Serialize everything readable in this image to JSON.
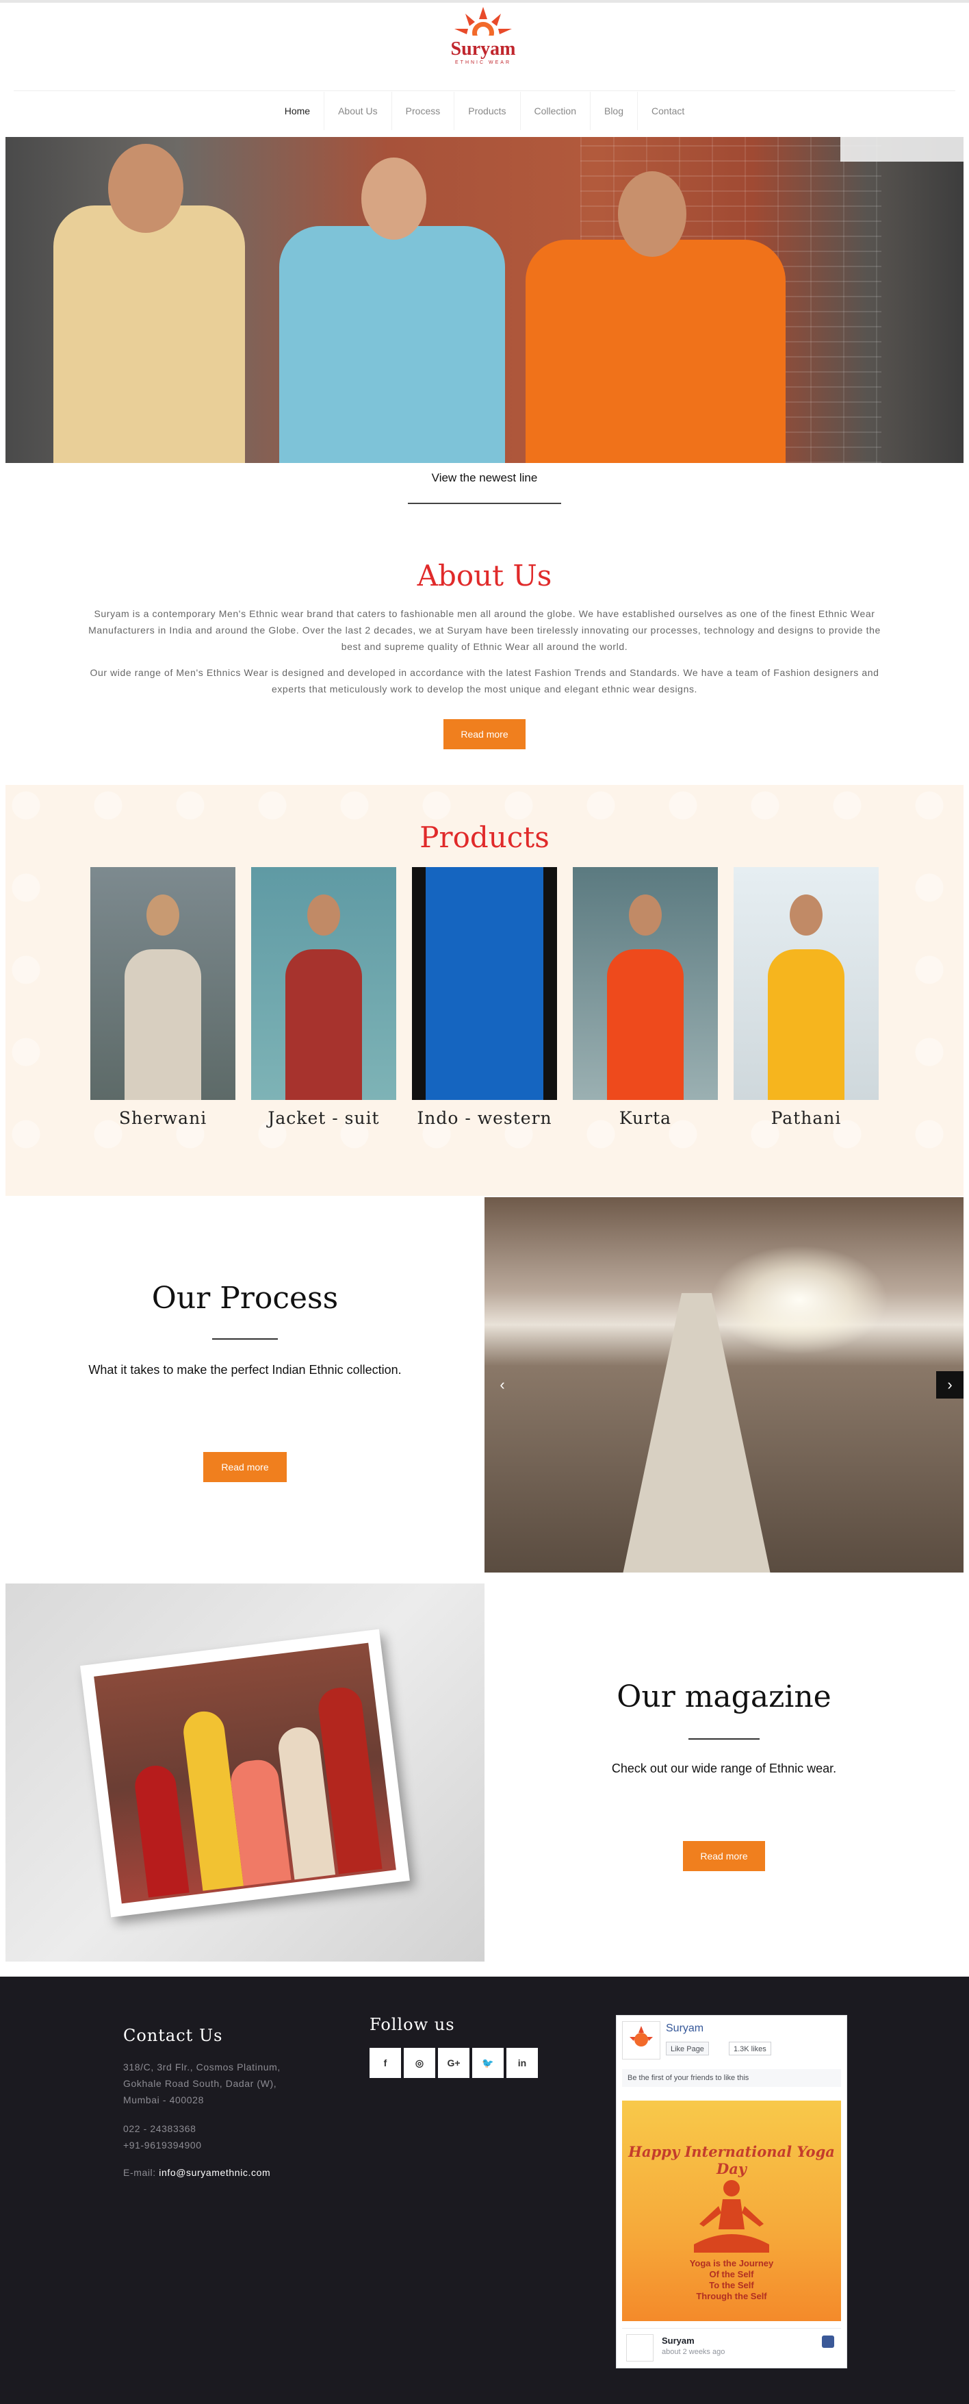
{
  "brand": {
    "name": "Suryam",
    "tagline": "ETHNIC WEAR"
  },
  "nav": [
    {
      "label": "Home"
    },
    {
      "label": "About Us"
    },
    {
      "label": "Process"
    },
    {
      "label": "Products"
    },
    {
      "label": "Collection"
    },
    {
      "label": "Blog"
    },
    {
      "label": "Contact"
    }
  ],
  "hero": {
    "cta": "View the newest line"
  },
  "about": {
    "title": "About Us",
    "p1": "Suryam is a contemporary Men's Ethnic wear brand that caters to fashionable men all around the globe. We have established ourselves as one of the finest Ethnic Wear Manufacturers in India and around the Globe. Over the last 2 decades, we at Suryam have been tirelessly innovating our processes, technology and designs to provide the best and supreme quality of Ethnic Wear all around the world.",
    "p2": "Our wide range of Men's Ethnics Wear is designed and developed in accordance with the latest Fashion Trends and Standards. We have a team of Fashion designers and experts that meticulously work to develop the most unique and elegant ethnic wear designs.",
    "button": "Read more"
  },
  "products": {
    "title": "Products",
    "items": [
      {
        "label": "Sherwani",
        "color": "#cfc6b8"
      },
      {
        "label": "Jacket - suit",
        "color": "#a7332d"
      },
      {
        "label": "Indo - western",
        "color": "#1565c0"
      },
      {
        "label": "Kurta",
        "color": "#ee4a1c"
      },
      {
        "label": "Pathani",
        "color": "#f6b51e"
      }
    ]
  },
  "process": {
    "title": "Our Process",
    "text": "What it takes to make the perfect Indian Ethnic collection.",
    "button": "Read more",
    "prev_icon": "chevron-left-icon",
    "next_icon": "chevron-right-icon"
  },
  "magazine": {
    "title": "Our magazine",
    "text": "Check out our wide range of Ethnic wear."
  },
  "footer": {
    "contact_title": "Contact Us",
    "address": [
      "318/C, 3rd Flr., Cosmos Platinum,",
      "Gokhale Road South, Dadar (W),",
      "Mumbai - 400028"
    ],
    "phones": [
      "022 - 24383368",
      "+91-9619394900"
    ],
    "email_label": "E-mail:",
    "email": "info@suryamethnic.com",
    "follow_title": "Follow us",
    "social": [
      {
        "icon": "facebook-icon",
        "glyph": "f"
      },
      {
        "icon": "instagram-icon",
        "glyph": "◎"
      },
      {
        "icon": "google-plus-icon",
        "glyph": "G+"
      },
      {
        "icon": "twitter-icon",
        "glyph": "🐦"
      },
      {
        "icon": "linkedin-icon",
        "glyph": "in"
      }
    ]
  },
  "facebook": {
    "page_name": "Suryam",
    "like_button": "Like Page",
    "likes": "1.3K likes",
    "friends_text": "Be the first of your friends to like this",
    "post_title": "Happy International Yoga Day",
    "post_lines": [
      "Yoga is the Journey",
      "Of the Self",
      "To the Self",
      "Through the Self"
    ],
    "post_author": "Suryam",
    "post_time": "about 2 weeks ago"
  },
  "colors": {
    "accent": "#f07f1e",
    "heading_red": "#e02a2a",
    "footer_bg": "#1b1a20"
  }
}
